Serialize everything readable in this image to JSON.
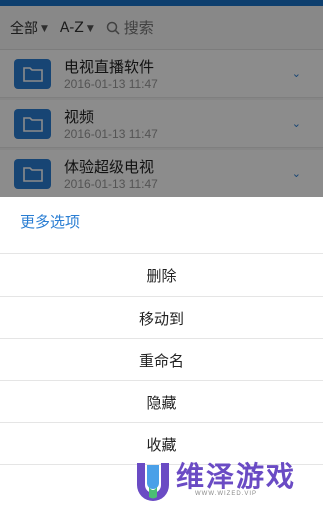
{
  "filter_bar": {
    "scope_label": "全部",
    "sort_label": "A-Z",
    "search_placeholder": "搜索"
  },
  "files": [
    {
      "name": "电视直播软件",
      "date": "2016-01-13 11:47"
    },
    {
      "name": "视频",
      "date": "2016-01-13 11:47"
    },
    {
      "name": "体验超级电视",
      "date": "2016-01-13 11:47"
    }
  ],
  "sheet": {
    "title": "更多选项",
    "items": [
      {
        "label": "删除"
      },
      {
        "label": "移动到"
      },
      {
        "label": "重命名"
      },
      {
        "label": "隐藏"
      },
      {
        "label": "收藏"
      }
    ]
  },
  "watermark": {
    "text": "维泽游戏",
    "sub": "WWW.WIZED.VIP"
  },
  "colors": {
    "accent": "#2a7ed3",
    "overlay": "rgba(0,0,0,0.45)",
    "watermark": "#6a4bc4"
  }
}
